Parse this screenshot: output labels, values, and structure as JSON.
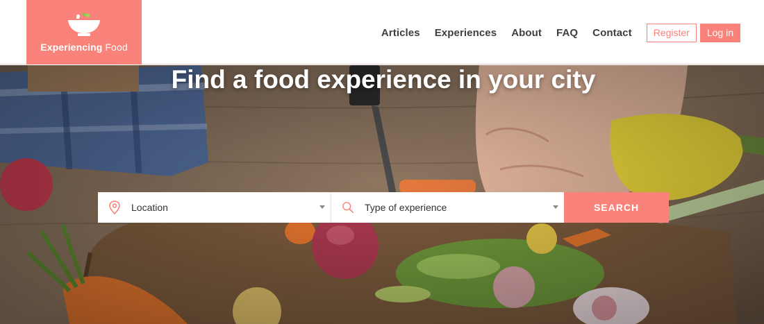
{
  "brand": {
    "name_bold": "Experiencing",
    "name_light": "Food",
    "accent": "#f9827a"
  },
  "nav": {
    "links": [
      "Articles",
      "Experiences",
      "About",
      "FAQ",
      "Contact"
    ],
    "register": "Register",
    "login": "Log in"
  },
  "hero": {
    "title": "Find a food experience in your city"
  },
  "search": {
    "location_placeholder": "Location",
    "type_placeholder": "Type of experience",
    "button": "SEARCH"
  },
  "icons": {
    "logo": "bowl-icon",
    "location": "location-pin-icon",
    "type": "search-icon",
    "dropdown": "caret-down-icon"
  }
}
